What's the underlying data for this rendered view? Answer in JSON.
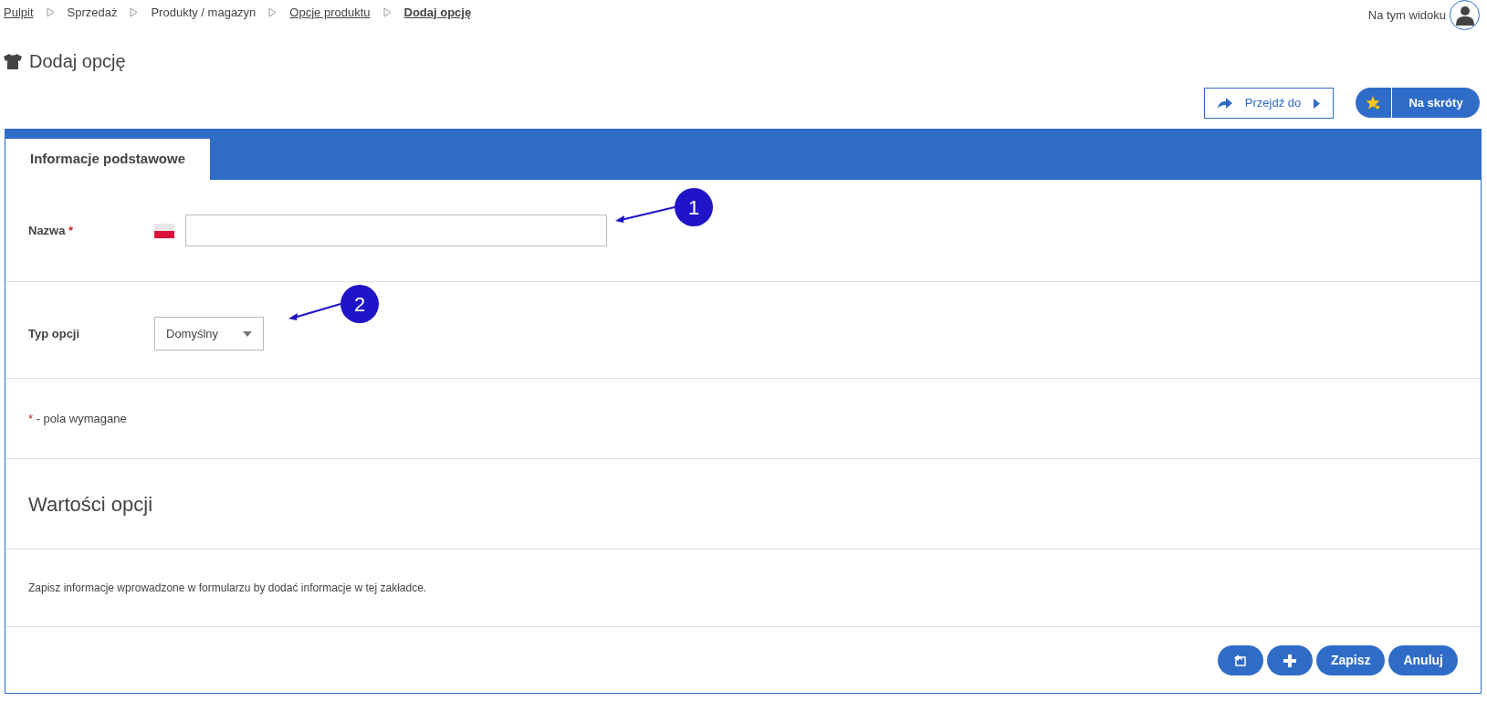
{
  "breadcrumb": [
    {
      "label": "Pulpit",
      "kind": "link",
      "selected": false
    },
    {
      "label": "Sprzedaż",
      "kind": "plain",
      "selected": false
    },
    {
      "label": "Produkty / magazyn",
      "kind": "plain",
      "selected": false
    },
    {
      "label": "Opcje produktu",
      "kind": "link",
      "selected": false
    },
    {
      "label": "Dodaj opcję",
      "kind": "link",
      "selected": true
    }
  ],
  "user_menu": {
    "label": "Na tym widoku"
  },
  "page_title": "Dodaj opcję",
  "toolbar": {
    "goto_button": "Przejdź do",
    "shortcuts_button": "Na skróty"
  },
  "tabs": [
    {
      "label": "Informacje podstawowe",
      "selected": true
    }
  ],
  "form": {
    "fields": [
      {
        "label": "Nazwa",
        "required": "*",
        "kind": "text"
      },
      {
        "label": "Typ opcji",
        "kind": "select",
        "value": "Domyślny"
      }
    ],
    "required_note": {
      "mark": "*",
      "text": "- pola wymagane"
    }
  },
  "values_section": {
    "title": "Wartości opcji",
    "note": "Zapisz informacje wprowadzone w formularzu by dodać informacje w tej zakładce."
  },
  "footer_buttons": [
    {
      "kind": "icon-back"
    },
    {
      "kind": "icon-plus"
    },
    {
      "kind": "text",
      "label": "Zapisz"
    },
    {
      "kind": "text",
      "label": "Anuluj"
    }
  ],
  "annotations": [
    "1",
    "2"
  ]
}
